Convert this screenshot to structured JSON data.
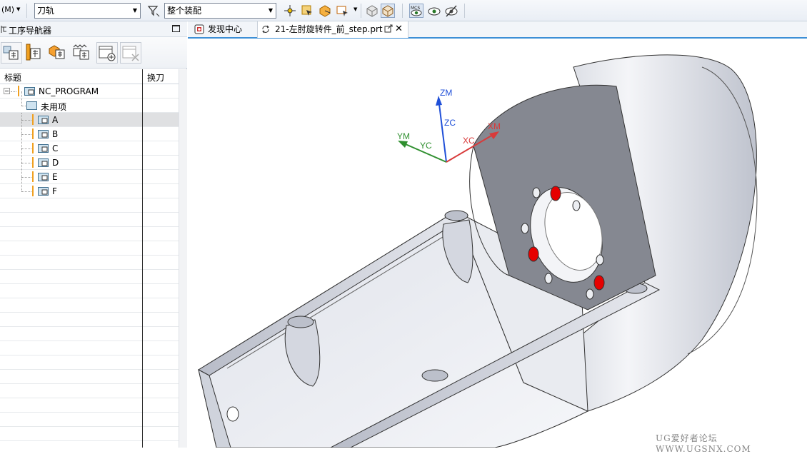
{
  "toolbar": {
    "menu_label": "(M)",
    "filter_combo_value": "刀轨",
    "selection_scope_value": "整个装配"
  },
  "navigator": {
    "title": "工序导航器",
    "columns": [
      "标题",
      "换刀"
    ],
    "root": "NC_PROGRAM",
    "unused_group": "未用项",
    "programs": [
      "A",
      "B",
      "C",
      "D",
      "E",
      "F"
    ],
    "selected_program": "A"
  },
  "tabs": [
    {
      "label": "发现中心",
      "active": false
    },
    {
      "label": "21-左肘旋转件_前_step.prt",
      "active": true
    }
  ],
  "viewport": {
    "csys_labels": {
      "zm": "ZM",
      "zc": "ZC",
      "ym": "YM",
      "yc": "YC",
      "xm": "XM",
      "xc": "XC"
    },
    "axis_colors": {
      "z": "#1f4fd8",
      "y": "#2f8f2f",
      "x": "#d83a3a"
    },
    "highlight_color": "#e60000",
    "watermark": "UG爱好者论坛 WWW.UGSNX.COM"
  }
}
